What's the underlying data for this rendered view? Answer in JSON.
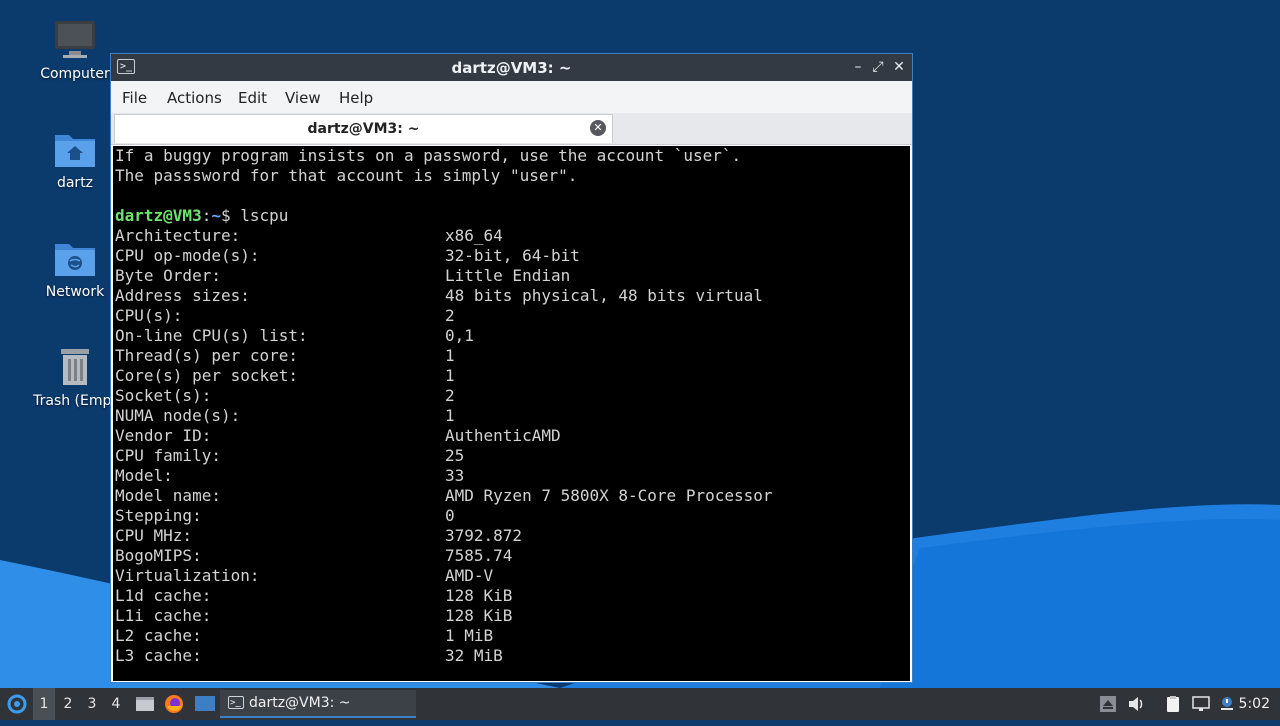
{
  "desktop": {
    "icons": [
      {
        "label": "Computer",
        "icon": "monitor-icon"
      },
      {
        "label": "dartz",
        "icon": "home-folder-icon"
      },
      {
        "label": "Network",
        "icon": "network-folder-icon"
      },
      {
        "label": "Trash (Empt",
        "icon": "trash-icon"
      }
    ]
  },
  "window": {
    "title": "dartz@VM3: ~",
    "menu": [
      "File",
      "Actions",
      "Edit",
      "View",
      "Help"
    ],
    "tab_label": "dartz@VM3: ~",
    "controls": {
      "minimize": "–",
      "maximize": "⤢",
      "close": "✕"
    }
  },
  "terminal": {
    "motd": [
      "If a buggy program insists on a password, use the account `user`.",
      "The passsword for that account is simply \"user\"."
    ],
    "prompt": {
      "user_host": "dartz@VM3",
      "sep": ":",
      "path": "~",
      "symbol": "$ ",
      "command": "lscpu"
    },
    "rows": [
      {
        "key": "Architecture:",
        "value": "x86_64"
      },
      {
        "key": "CPU op-mode(s):",
        "value": "32-bit, 64-bit"
      },
      {
        "key": "Byte Order:",
        "value": "Little Endian"
      },
      {
        "key": "Address sizes:",
        "value": "48 bits physical, 48 bits virtual"
      },
      {
        "key": "CPU(s):",
        "value": "2"
      },
      {
        "key": "On-line CPU(s) list:",
        "value": "0,1"
      },
      {
        "key": "Thread(s) per core:",
        "value": "1"
      },
      {
        "key": "Core(s) per socket:",
        "value": "1"
      },
      {
        "key": "Socket(s):",
        "value": "2"
      },
      {
        "key": "NUMA node(s):",
        "value": "1"
      },
      {
        "key": "Vendor ID:",
        "value": "AuthenticAMD"
      },
      {
        "key": "CPU family:",
        "value": "25"
      },
      {
        "key": "Model:",
        "value": "33"
      },
      {
        "key": "Model name:",
        "value": "AMD Ryzen 7 5800X 8-Core Processor"
      },
      {
        "key": "Stepping:",
        "value": "0"
      },
      {
        "key": "CPU MHz:",
        "value": "3792.872"
      },
      {
        "key": "BogoMIPS:",
        "value": "7585.74"
      },
      {
        "key": "Virtualization:",
        "value": "AMD-V"
      },
      {
        "key": "L1d cache:",
        "value": "128 KiB"
      },
      {
        "key": "L1i cache:",
        "value": "128 KiB"
      },
      {
        "key": "L2 cache:",
        "value": "1 MiB"
      },
      {
        "key": "L3 cache:",
        "value": "32 MiB"
      }
    ]
  },
  "taskbar": {
    "workspaces": [
      "1",
      "2",
      "3",
      "4"
    ],
    "active_workspace": "1",
    "launchers": [
      "file-manager-icon",
      "firefox-icon",
      "desktop-icon"
    ],
    "task_label": "dartz@VM3: ~",
    "tray": [
      "eject-icon",
      "volume-icon",
      "clipboard-icon",
      "network-icon",
      "notification-icon"
    ],
    "clock": "5:02"
  },
  "colors": {
    "accent": "#3d7fc4",
    "prompt_user": "#6ee36e",
    "prompt_path": "#5fa8ff",
    "terminal_bg": "#000000",
    "taskbar_bg": "#303338"
  }
}
